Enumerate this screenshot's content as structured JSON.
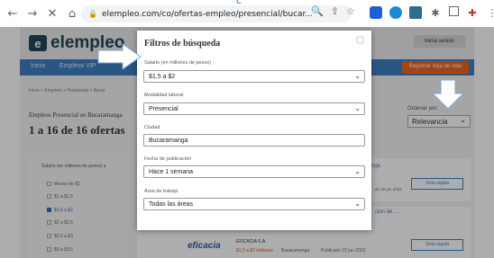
{
  "browser": {
    "url": "elempleo.com/co/ofertas-empleo/presencial/bucar...",
    "back_icon": "←",
    "forward_icon": "→",
    "close_icon": "✕",
    "home_icon": "⌂",
    "loading_glyph": "c"
  },
  "site": {
    "logo": "elempleo",
    "login_label": "Inicia sesión",
    "nav": [
      "Inicio",
      "Empleos VIP"
    ],
    "register_label": "Registrar hoja de vida",
    "breadcrumb": "Inicio  >  Empleos  >  Presencial  >  Bucar",
    "results_title": "Empleos Presencial en Bucaramanga",
    "results_count": "1 a 16 de 16 ofertas",
    "sort_label": "Ordenar por:",
    "sort_value": "Relevancia",
    "filter_title": "Salario (en millones de pesos)",
    "filter_options": [
      {
        "label": "Menos de $1",
        "checked": false
      },
      {
        "label": "$1 a $1,5",
        "checked": false
      },
      {
        "label": "$1,5 a $2",
        "checked": true
      },
      {
        "label": "$2 a $2,5",
        "checked": false
      },
      {
        "label": "$2,5 a $3",
        "checked": false
      },
      {
        "label": "$3 a $3,5",
        "checked": false
      }
    ],
    "vista_label": "Vista rápida",
    "card1_frag": "nge",
    "card1_date": "do 22 jun 2022",
    "card2_frag": "ción de ...",
    "company": {
      "logo_text": "eficacia",
      "name": "EFICACIA S.A.",
      "salary": "$1,5 a $2 millones",
      "location": "Bucaramanga",
      "date": "Publicado 22 jun 2022"
    }
  },
  "modal": {
    "title": "Filtros de búsqueda",
    "fields": [
      {
        "label": "Salario (en millones de pesos)",
        "value": "$1,5 a $2",
        "type": "select"
      },
      {
        "label": "Modalidad laboral",
        "value": "Presencial",
        "type": "select"
      },
      {
        "label": "Ciudad",
        "value": "Bucaramanga",
        "type": "input"
      },
      {
        "label": "Fecha de publicación",
        "value": "Hace 1 semana",
        "type": "select"
      },
      {
        "label": "Área de trabajo",
        "value": "Todas las áreas",
        "type": "select"
      }
    ]
  },
  "colors": {
    "overlay": "#00000052",
    "nav_blue": "#3d7fc4",
    "register_orange": "#f0621d"
  }
}
